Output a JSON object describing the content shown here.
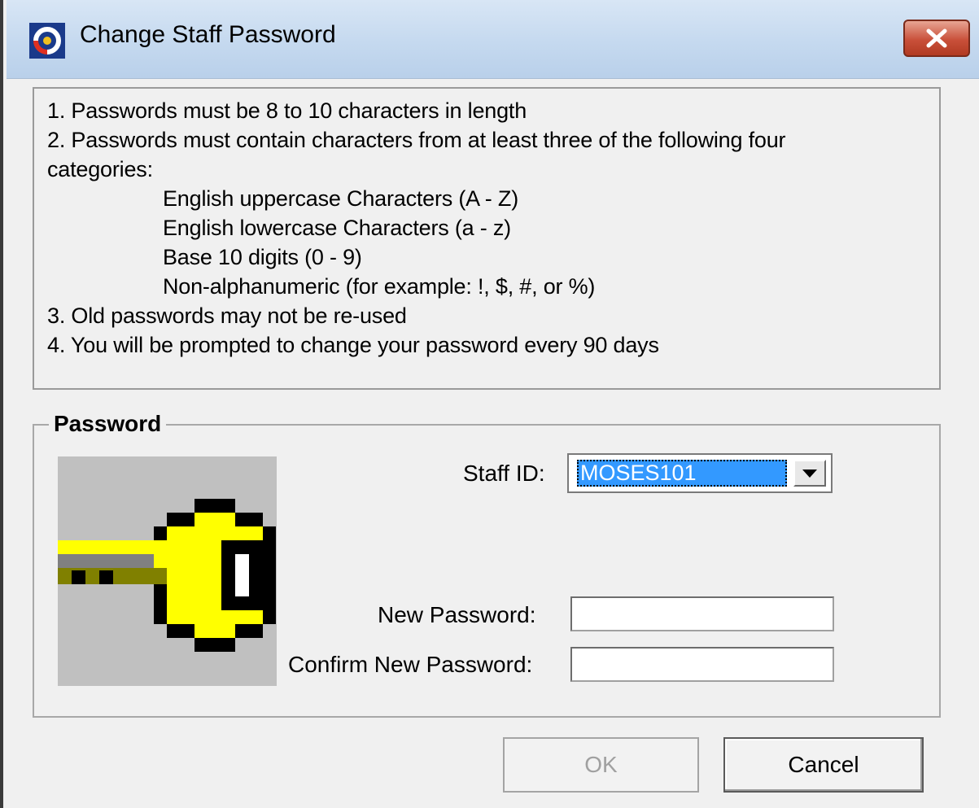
{
  "window": {
    "title": "Change Staff Password",
    "close_label": "✕"
  },
  "rules": {
    "line1": "1. Passwords must be 8 to 10 characters in length",
    "line2": "2. Passwords must contain characters from at least three of the following four",
    "line2b": "categories:",
    "categories": [
      "English uppercase Characters (A - Z)",
      "English lowercase Characters (a - z)",
      "Base 10 digits (0 - 9)",
      "Non-alphanumeric (for example: !, $, #, or %)"
    ],
    "line3": "3. Old passwords may not be re-used",
    "line4": "4. You will be prompted to change your password every 90 days"
  },
  "password_group": {
    "legend": "Password",
    "staff_id_label": "Staff ID:",
    "staff_id_value": "MOSES101",
    "new_password_label": "New Password:",
    "new_password_value": "",
    "confirm_password_label": "Confirm New Password:",
    "confirm_password_value": ""
  },
  "buttons": {
    "ok": "OK",
    "cancel": "Cancel"
  },
  "colors": {
    "selection": "#3399ff",
    "key": "#ffff00",
    "close_button": "#c9503a"
  }
}
